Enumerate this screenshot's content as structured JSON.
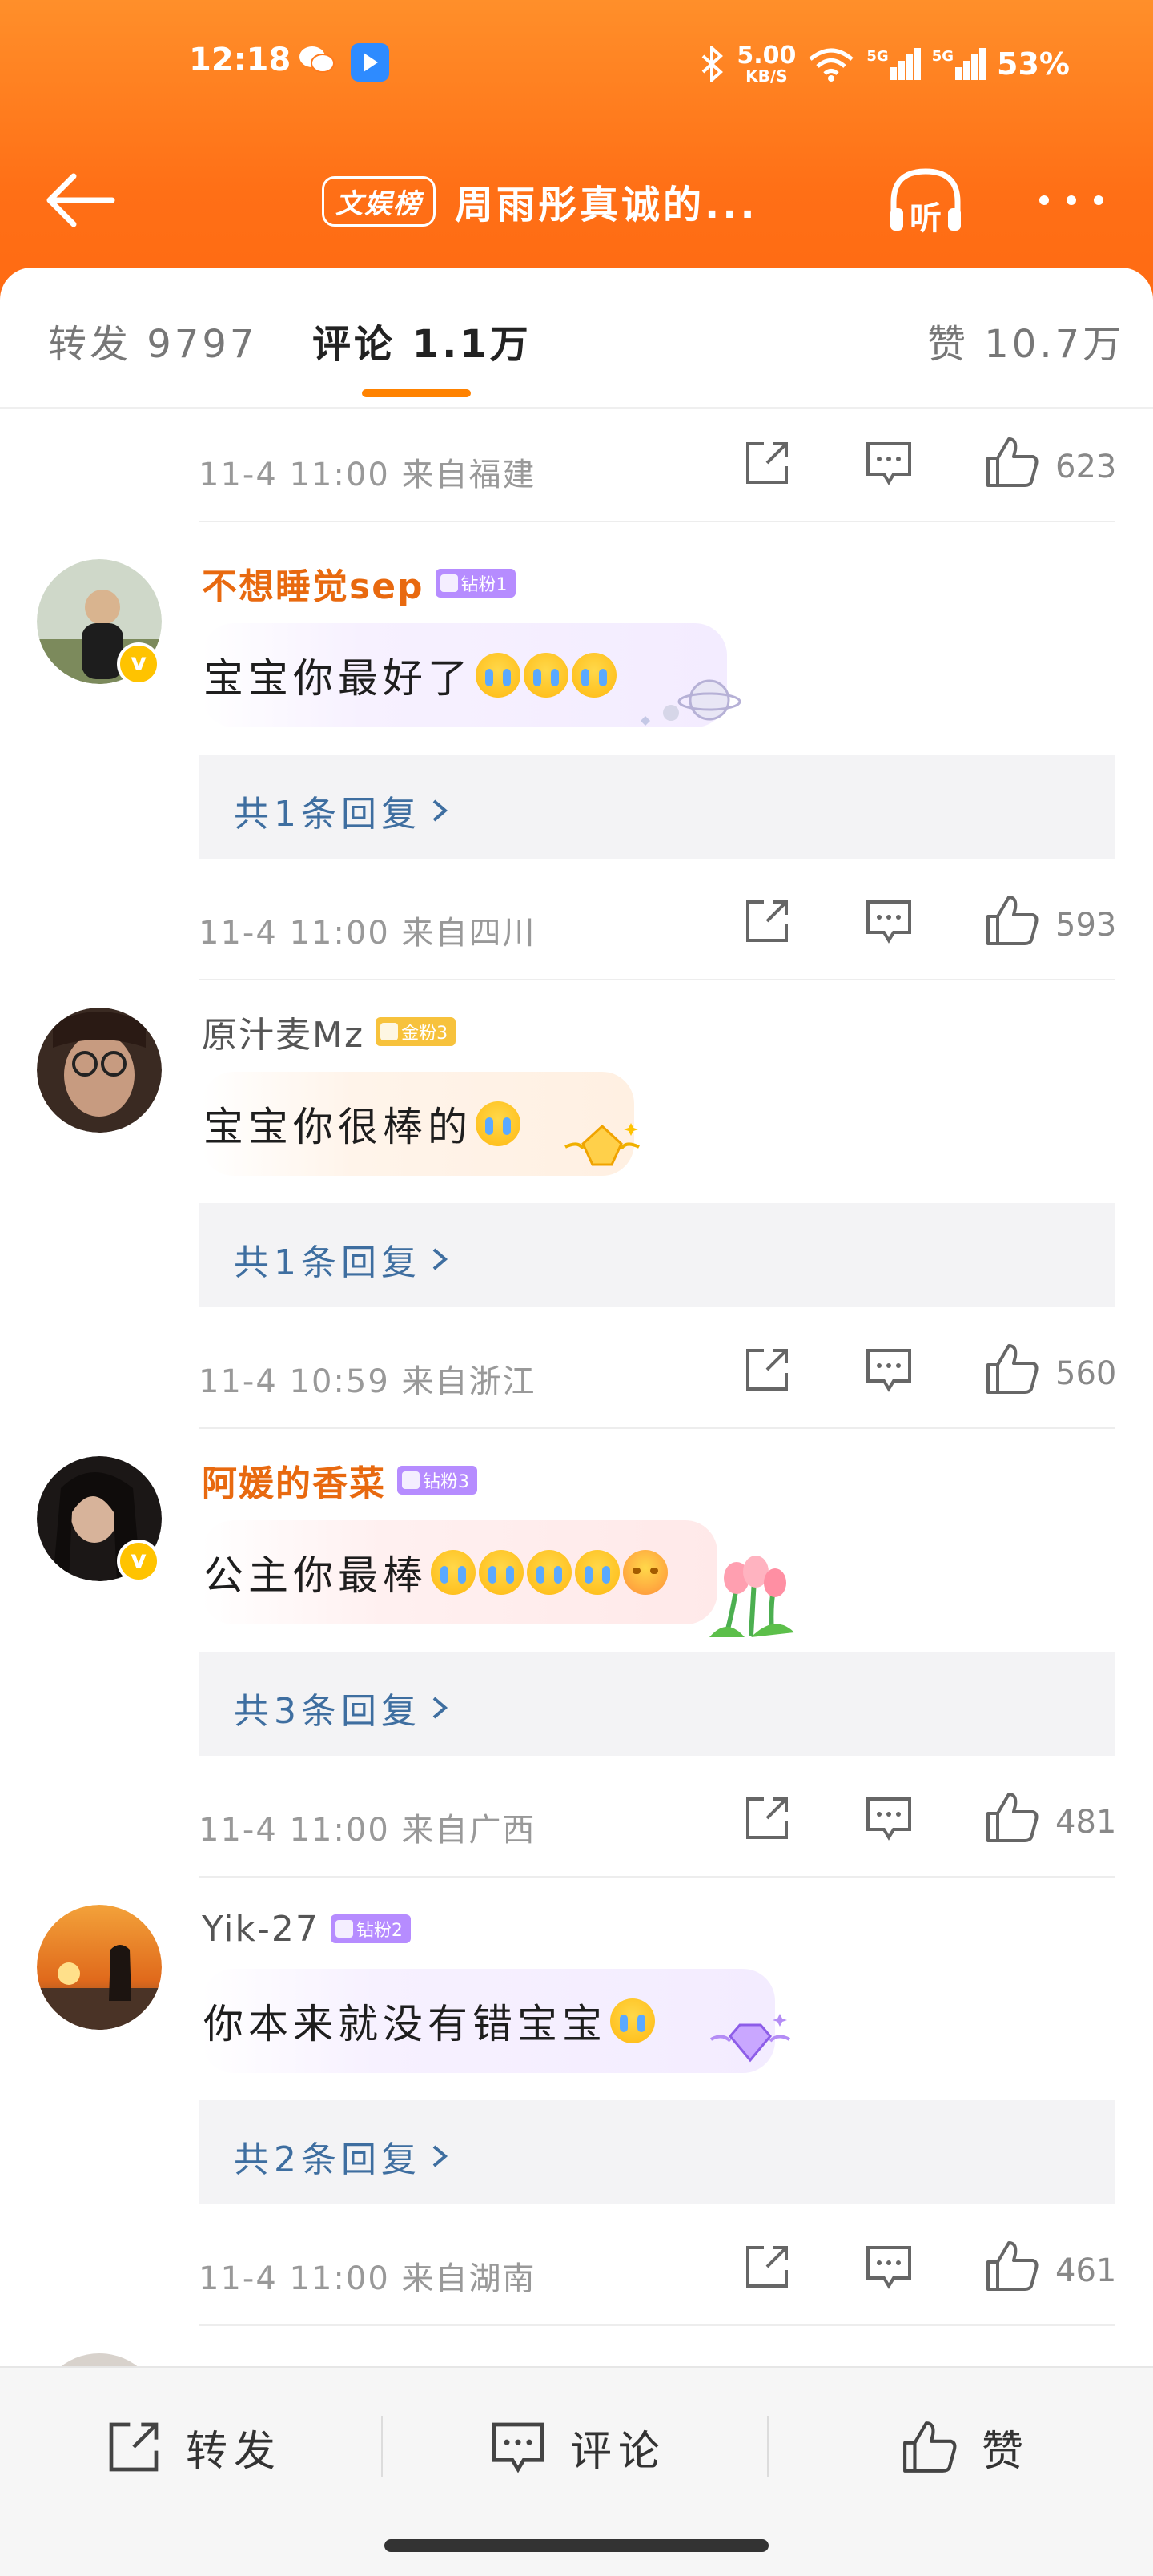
{
  "status_bar": {
    "time": "12:18",
    "net_speed_value": "5.00",
    "net_speed_unit": "KB/S",
    "signal_1": "5G",
    "signal_2": "5G",
    "battery": "53%"
  },
  "nav": {
    "badge": "文娱榜",
    "title": "周雨彤真诚的...",
    "listen_label": "听"
  },
  "tabs": {
    "repost": "转发 9797",
    "comments": "评论 1.1万",
    "likes": "赞 10.7万"
  },
  "top_partial": {
    "meta": "11-4 11:00  来自福建",
    "likes": "623"
  },
  "comments": [
    {
      "username": "不想睡觉sep",
      "fan_badge": "钻粉1",
      "text": "宝宝你最好了",
      "reply": "共1条回复",
      "meta": "11-4 11:00  来自四川",
      "likes": "593"
    },
    {
      "username": "原汁麦Mz",
      "fan_badge": "金粉3",
      "text": "宝宝你很棒的",
      "reply": "共1条回复",
      "meta": "11-4 10:59  来自浙江",
      "likes": "560"
    },
    {
      "username": "阿媛的香菜",
      "fan_badge": "钻粉3",
      "text": "公主你最棒",
      "reply": "共3条回复",
      "meta": "11-4 11:00  来自广西",
      "likes": "481"
    },
    {
      "username": "Yik-27",
      "fan_badge": "钻粉2",
      "text": "你本来就没有错宝宝",
      "reply": "共2条回复",
      "meta": "11-4 11:00  来自湖南",
      "likes": "461"
    }
  ],
  "bottom_bar": {
    "repost": "转发",
    "comment": "评论",
    "like": "赞"
  },
  "colors": {
    "header_orange": "#ff7a1c",
    "username_orange": "#e8690f",
    "link_blue": "#3e6ea0",
    "tab_indicator": "#ff8200"
  }
}
